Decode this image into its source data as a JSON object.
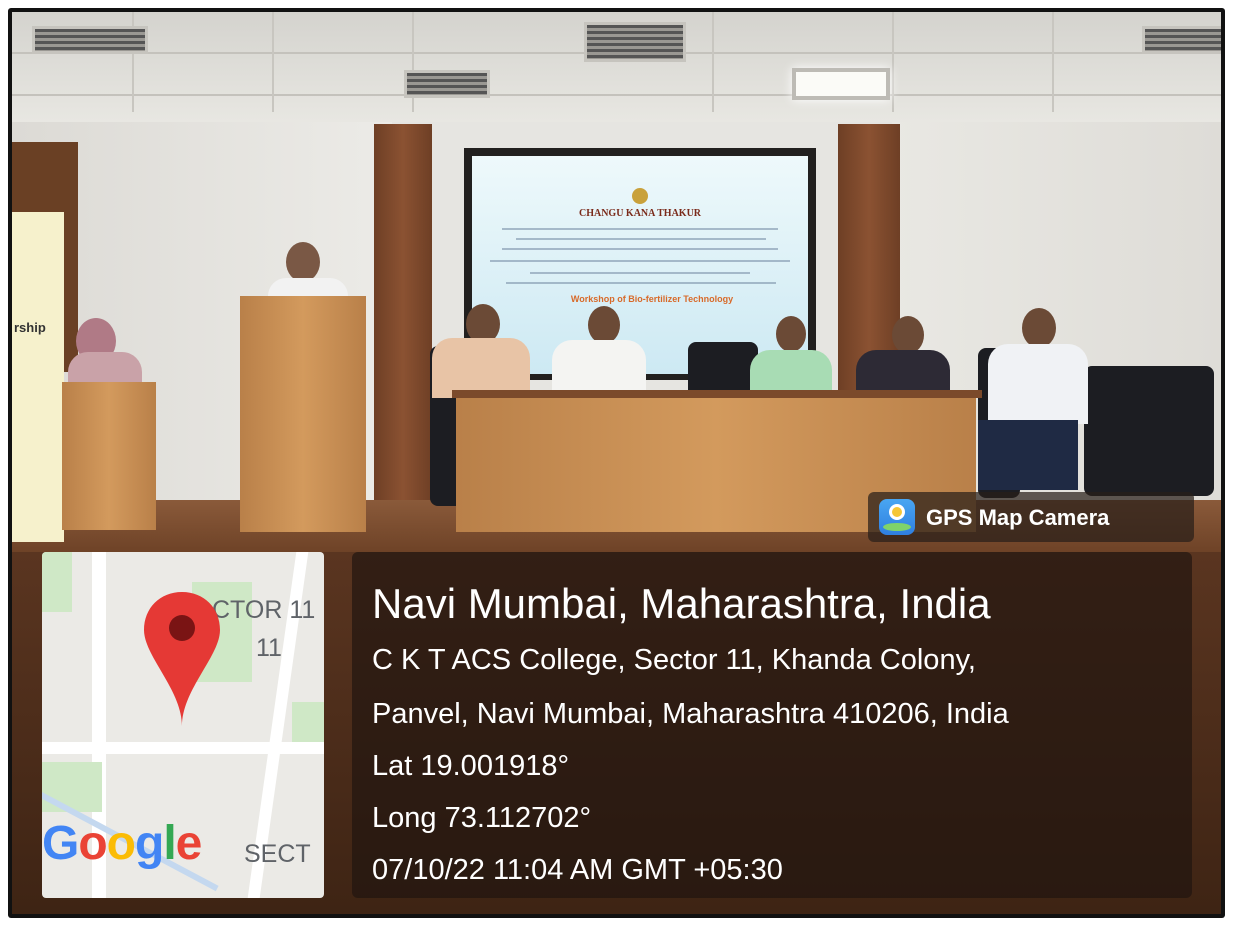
{
  "badge": {
    "label": "GPS Map Camera",
    "icon": "gps-map-camera-icon"
  },
  "location": {
    "title": "Navi Mumbai, Maharashtra, India",
    "address_line1": "C K T ACS College, Sector 11, Khanda Colony,",
    "address_line2": "Panvel, Navi Mumbai, Maharashtra 410206, India",
    "latitude": "Lat 19.001918°",
    "longitude": "Long 73.112702°",
    "datetime": "07/10/22 11:04 AM GMT +05:30"
  },
  "map": {
    "sector_label_1": "CTOR 11",
    "sector_label_2": "11",
    "sector_label_bottom": "SECT",
    "logo": "Google",
    "pin_color": "#e53935"
  },
  "scene": {
    "screen_title": "CHANGU KANA THAKUR",
    "screen_event": "Workshop of Bio-fertilizer Technology",
    "banner_text": "rship"
  },
  "colors": {
    "overlay": "#1e140f",
    "text": "#ffffff",
    "google_blue": "#4285f4",
    "google_red": "#ea4335",
    "google_yellow": "#fbbc05",
    "google_green": "#34a853"
  }
}
